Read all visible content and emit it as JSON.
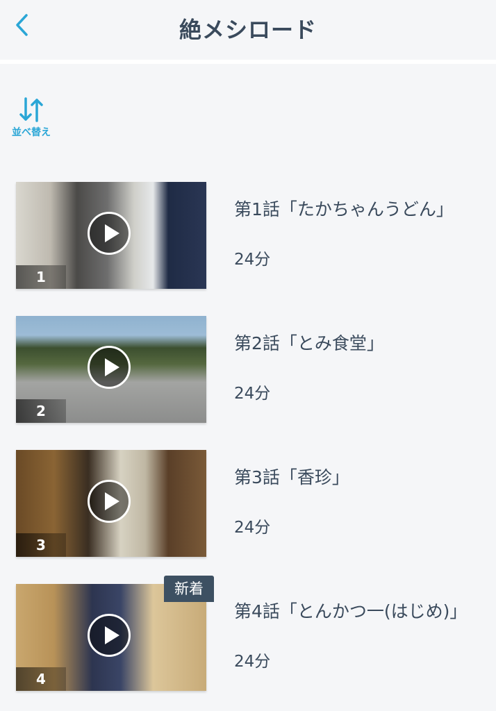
{
  "header": {
    "title": "絶メシロード",
    "back_icon": "chevron-left-icon"
  },
  "sort": {
    "label": "並べ替え",
    "icon": "sort-arrows-icon"
  },
  "colors": {
    "accent": "#2aa6d6",
    "text": "#3a4a5c",
    "badge": "#3d5062",
    "background": "#f5f6f8"
  },
  "episodes": [
    {
      "number": "1",
      "title": "第1話「たかちゃんうどん」",
      "duration": "24分",
      "badge": ""
    },
    {
      "number": "2",
      "title": "第2話「とみ食堂」",
      "duration": "24分",
      "badge": ""
    },
    {
      "number": "3",
      "title": "第3話「香珍」",
      "duration": "24分",
      "badge": ""
    },
    {
      "number": "4",
      "title": "第4話「とんかつ一(はじめ)」",
      "duration": "24分",
      "badge": "新着"
    }
  ]
}
